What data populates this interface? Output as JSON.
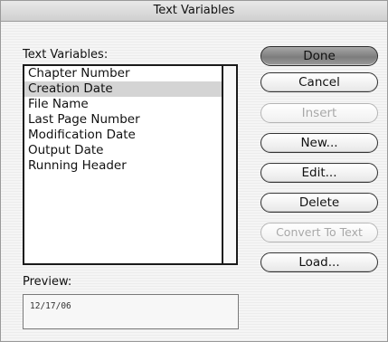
{
  "window": {
    "title": "Text Variables"
  },
  "variables": {
    "label": "Text Variables:",
    "items": [
      {
        "label": "Chapter Number",
        "selected": false
      },
      {
        "label": "Creation Date",
        "selected": true
      },
      {
        "label": "File Name",
        "selected": false
      },
      {
        "label": "Last Page Number",
        "selected": false
      },
      {
        "label": "Modification Date",
        "selected": false
      },
      {
        "label": "Output Date",
        "selected": false
      },
      {
        "label": "Running Header",
        "selected": false
      }
    ]
  },
  "preview": {
    "label": "Preview:",
    "value": "12/17/06"
  },
  "buttons": {
    "done": "Done",
    "cancel": "Cancel",
    "insert": "Insert",
    "new": "New...",
    "edit": "Edit...",
    "delete": "Delete",
    "convert": "Convert To Text",
    "load": "Load..."
  }
}
